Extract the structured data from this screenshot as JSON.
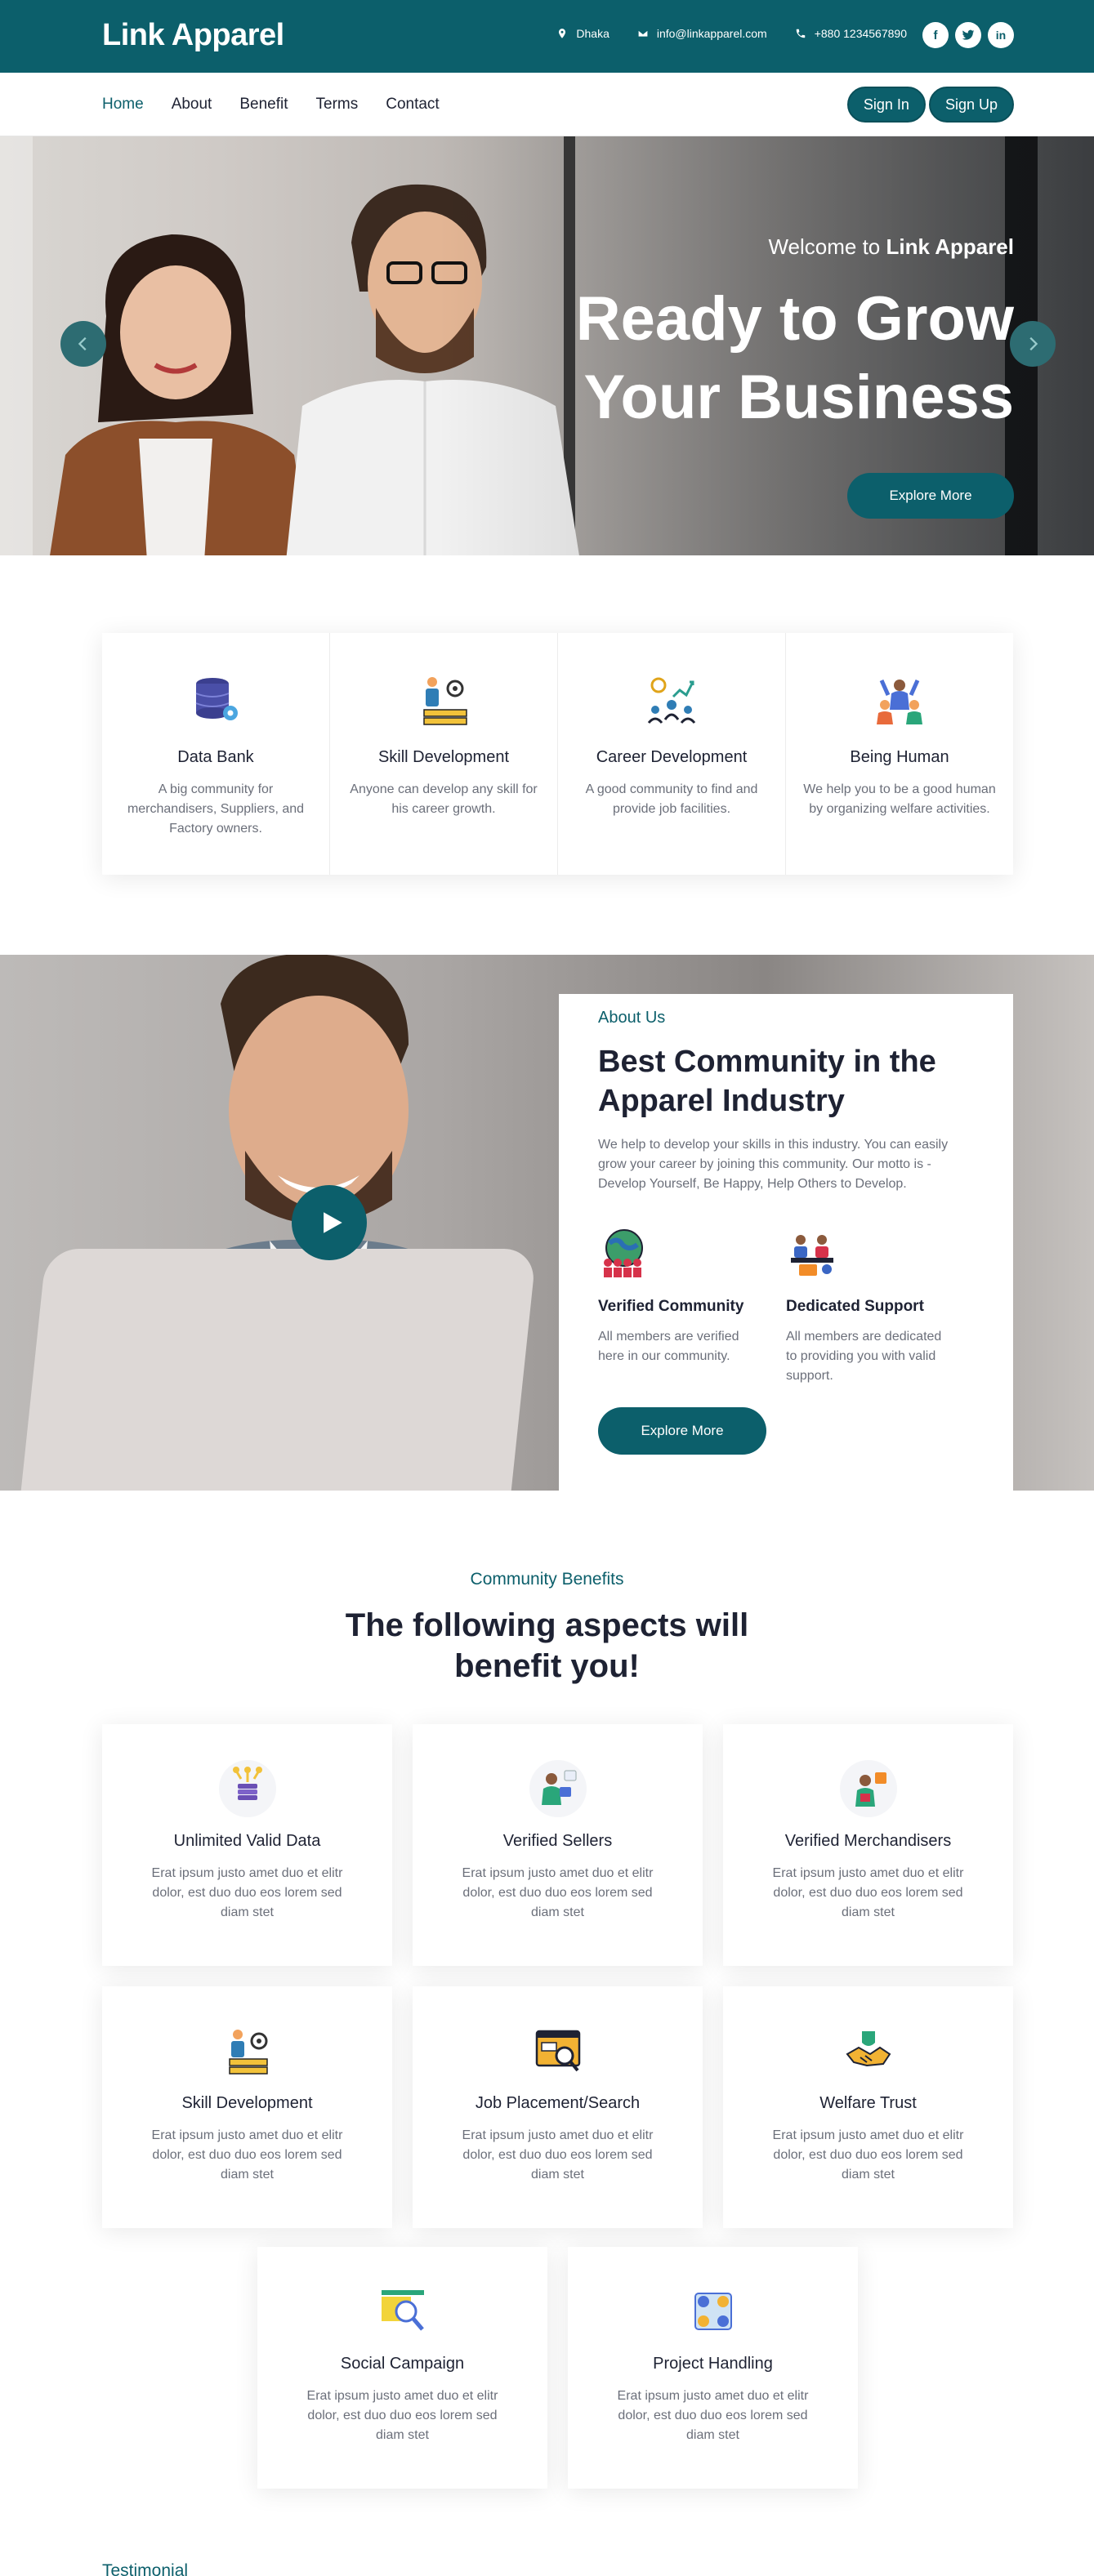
{
  "topbar": {
    "brand": "Link Apparel",
    "location": "Dhaka",
    "email": "info@linkapparel.com",
    "phone": "+880 1234567890",
    "socials": [
      "facebook-icon",
      "twitter-icon",
      "linkedin-icon"
    ]
  },
  "nav": {
    "links": [
      "Home",
      "About",
      "Benefit",
      "Terms",
      "Contact"
    ],
    "sign_in": "Sign In",
    "sign_up": "Sign Up"
  },
  "hero": {
    "welcome_prefix": "Welcome to ",
    "welcome_brand": "Link Apparel",
    "title": "Ready to Grow Your Business",
    "button": "Explore More"
  },
  "features": [
    {
      "icon": "database-icon",
      "title": "Data Bank",
      "text": "A big community for merchandisers, Suppliers, and Factory owners."
    },
    {
      "icon": "skill-development-icon",
      "title": "Skill Development",
      "text": "Anyone can develop any skill for his career growth."
    },
    {
      "icon": "career-development-icon",
      "title": "Career Development",
      "text": "A good community to find and provide job facilities."
    },
    {
      "icon": "people-icon",
      "title": "Being Human",
      "text": "We help you to be a good human by organizing welfare activities."
    }
  ],
  "about": {
    "kicker": "About Us",
    "title": "Best Community in the Apparel Industry",
    "desc": "We help to develop your skills in this industry. You can easily grow your career by joining this community. Our motto is - Develop Yourself, Be Happy, Help Others to Develop.",
    "items": [
      {
        "icon": "verified-community-icon",
        "title": "Verified Community",
        "text": "All members are verified here in our community."
      },
      {
        "icon": "dedicated-support-icon",
        "title": "Dedicated Support",
        "text": "All members are dedicated to providing you with valid support."
      }
    ],
    "button": "Explore More"
  },
  "benefits": {
    "kicker": "Community Benefits",
    "title": "The following aspects will benefit you!",
    "cards": [
      {
        "icon": "data-stack-icon",
        "title": "Unlimited Valid Data",
        "text": "Erat ipsum justo amet duo et elitr dolor, est duo duo eos lorem sed diam stet"
      },
      {
        "icon": "seller-icon",
        "title": "Verified Sellers",
        "text": "Erat ipsum justo amet duo et elitr dolor, est duo duo eos lorem sed diam stet"
      },
      {
        "icon": "merchandiser-icon",
        "title": "Verified Merchandisers",
        "text": "Erat ipsum justo amet duo et elitr dolor, est duo duo eos lorem sed diam stet"
      },
      {
        "icon": "skill-development-icon",
        "title": "Skill Development",
        "text": "Erat ipsum justo amet duo et elitr dolor, est duo duo eos lorem sed diam stet"
      },
      {
        "icon": "job-search-icon",
        "title": "Job Placement/Search",
        "text": "Erat ipsum justo amet duo et elitr dolor, est duo duo eos lorem sed diam stet"
      },
      {
        "icon": "handshake-icon",
        "title": "Welfare Trust",
        "text": "Erat ipsum justo amet duo et elitr dolor, est duo duo eos lorem sed diam stet"
      },
      {
        "icon": "social-campaign-icon",
        "title": "Social Campaign",
        "text": "Erat ipsum justo amet duo et elitr dolor, est duo duo eos lorem sed diam stet"
      },
      {
        "icon": "project-handling-icon",
        "title": "Project Handling",
        "text": "Erat ipsum justo amet duo et elitr dolor, est duo duo eos lorem sed diam stet"
      }
    ]
  },
  "next_section": {
    "kicker": "Testimonial"
  },
  "colors": {
    "primary": "#0c5f6b",
    "text": "#1e2233",
    "muted": "#6b6f7a"
  }
}
